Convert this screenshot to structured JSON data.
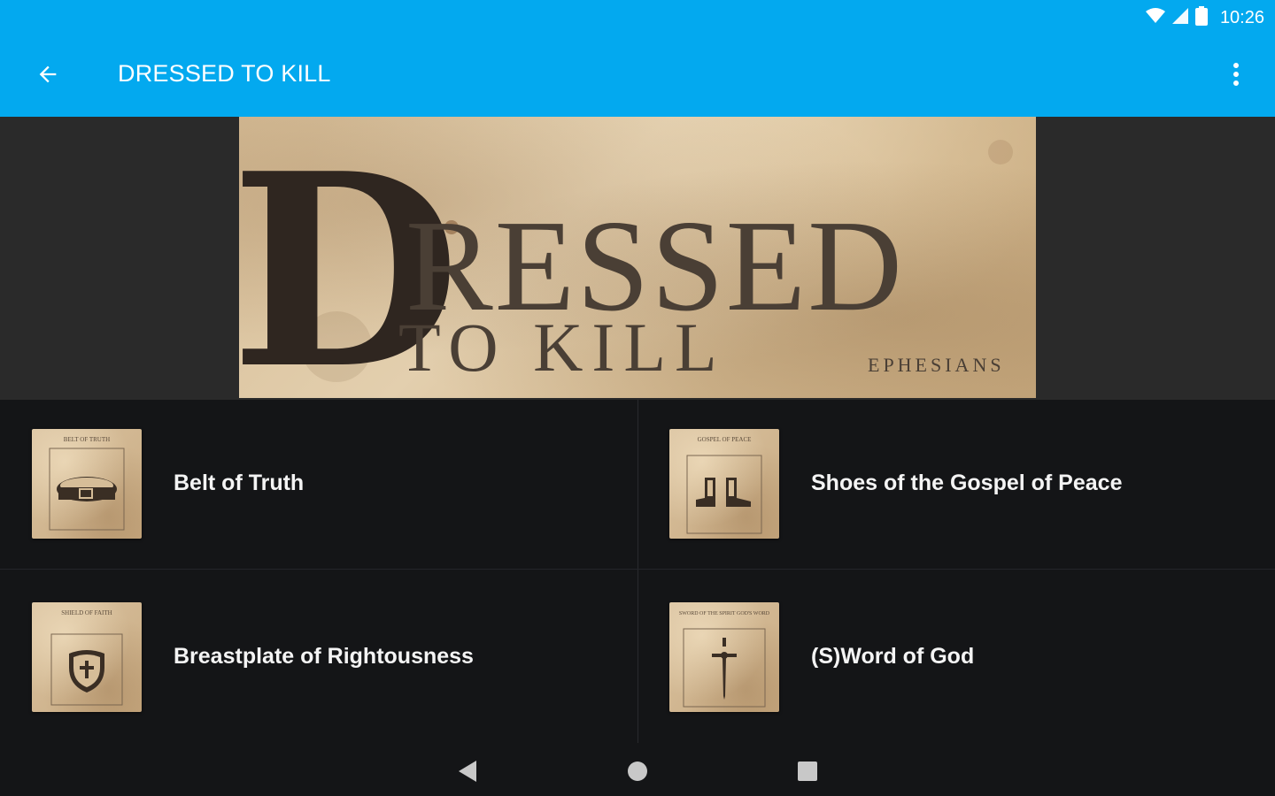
{
  "status_bar": {
    "time": "10:26"
  },
  "app_bar": {
    "title": "DRESSED TO KILL"
  },
  "banner": {
    "initial": "D",
    "word": "RESSED",
    "subtitle": "TO KILL",
    "tag": "EPHESIANS"
  },
  "items": [
    {
      "label": "Belt of Truth",
      "thumb_caption": "BELT OF TRUTH",
      "icon": "belt-icon"
    },
    {
      "label": "Shoes of the Gospel of Peace",
      "thumb_caption": "GOSPEL OF PEACE",
      "icon": "shoes-icon"
    },
    {
      "label": "Breastplate of Rightousness",
      "thumb_caption": "SHIELD OF FAITH",
      "icon": "shield-icon"
    },
    {
      "label": "(S)Word of God",
      "thumb_caption": "SWORD OF THE SPIRIT GOD'S WORD",
      "icon": "sword-icon"
    }
  ],
  "colors": {
    "primary": "#03a9ef",
    "background": "#141517",
    "parchment": "#d8bf99",
    "ink": "#3b3128"
  }
}
